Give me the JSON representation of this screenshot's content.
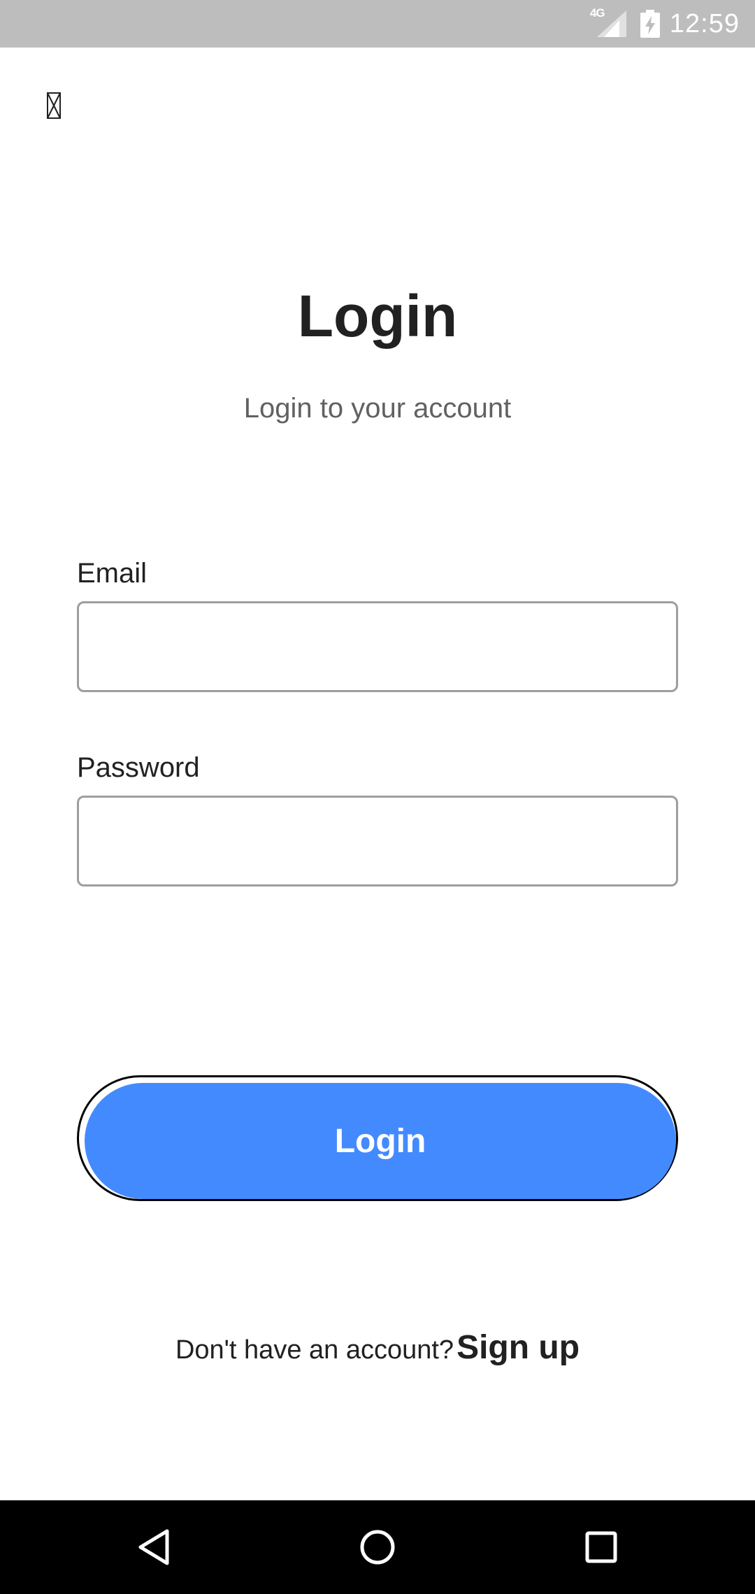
{
  "status_bar": {
    "network": "4G",
    "time": "12:59",
    "icons": [
      "signal-icon",
      "battery-charging-icon"
    ]
  },
  "header": {
    "close_icon": "close-icon"
  },
  "main": {
    "title": "Login",
    "subtitle": "Login to your account",
    "email": {
      "label": "Email",
      "value": ""
    },
    "password": {
      "label": "Password",
      "value": ""
    },
    "login_button": "Login",
    "signup_prompt": "Don't have an account?",
    "signup_link": "Sign up"
  },
  "nav_bar": {
    "icons": [
      "back-icon",
      "home-icon",
      "recents-icon"
    ]
  },
  "colors": {
    "accent": "#448aff",
    "status_bar": "#bdbdbd",
    "nav_bar": "#000000",
    "text": "#212121",
    "subtext": "#616161"
  }
}
